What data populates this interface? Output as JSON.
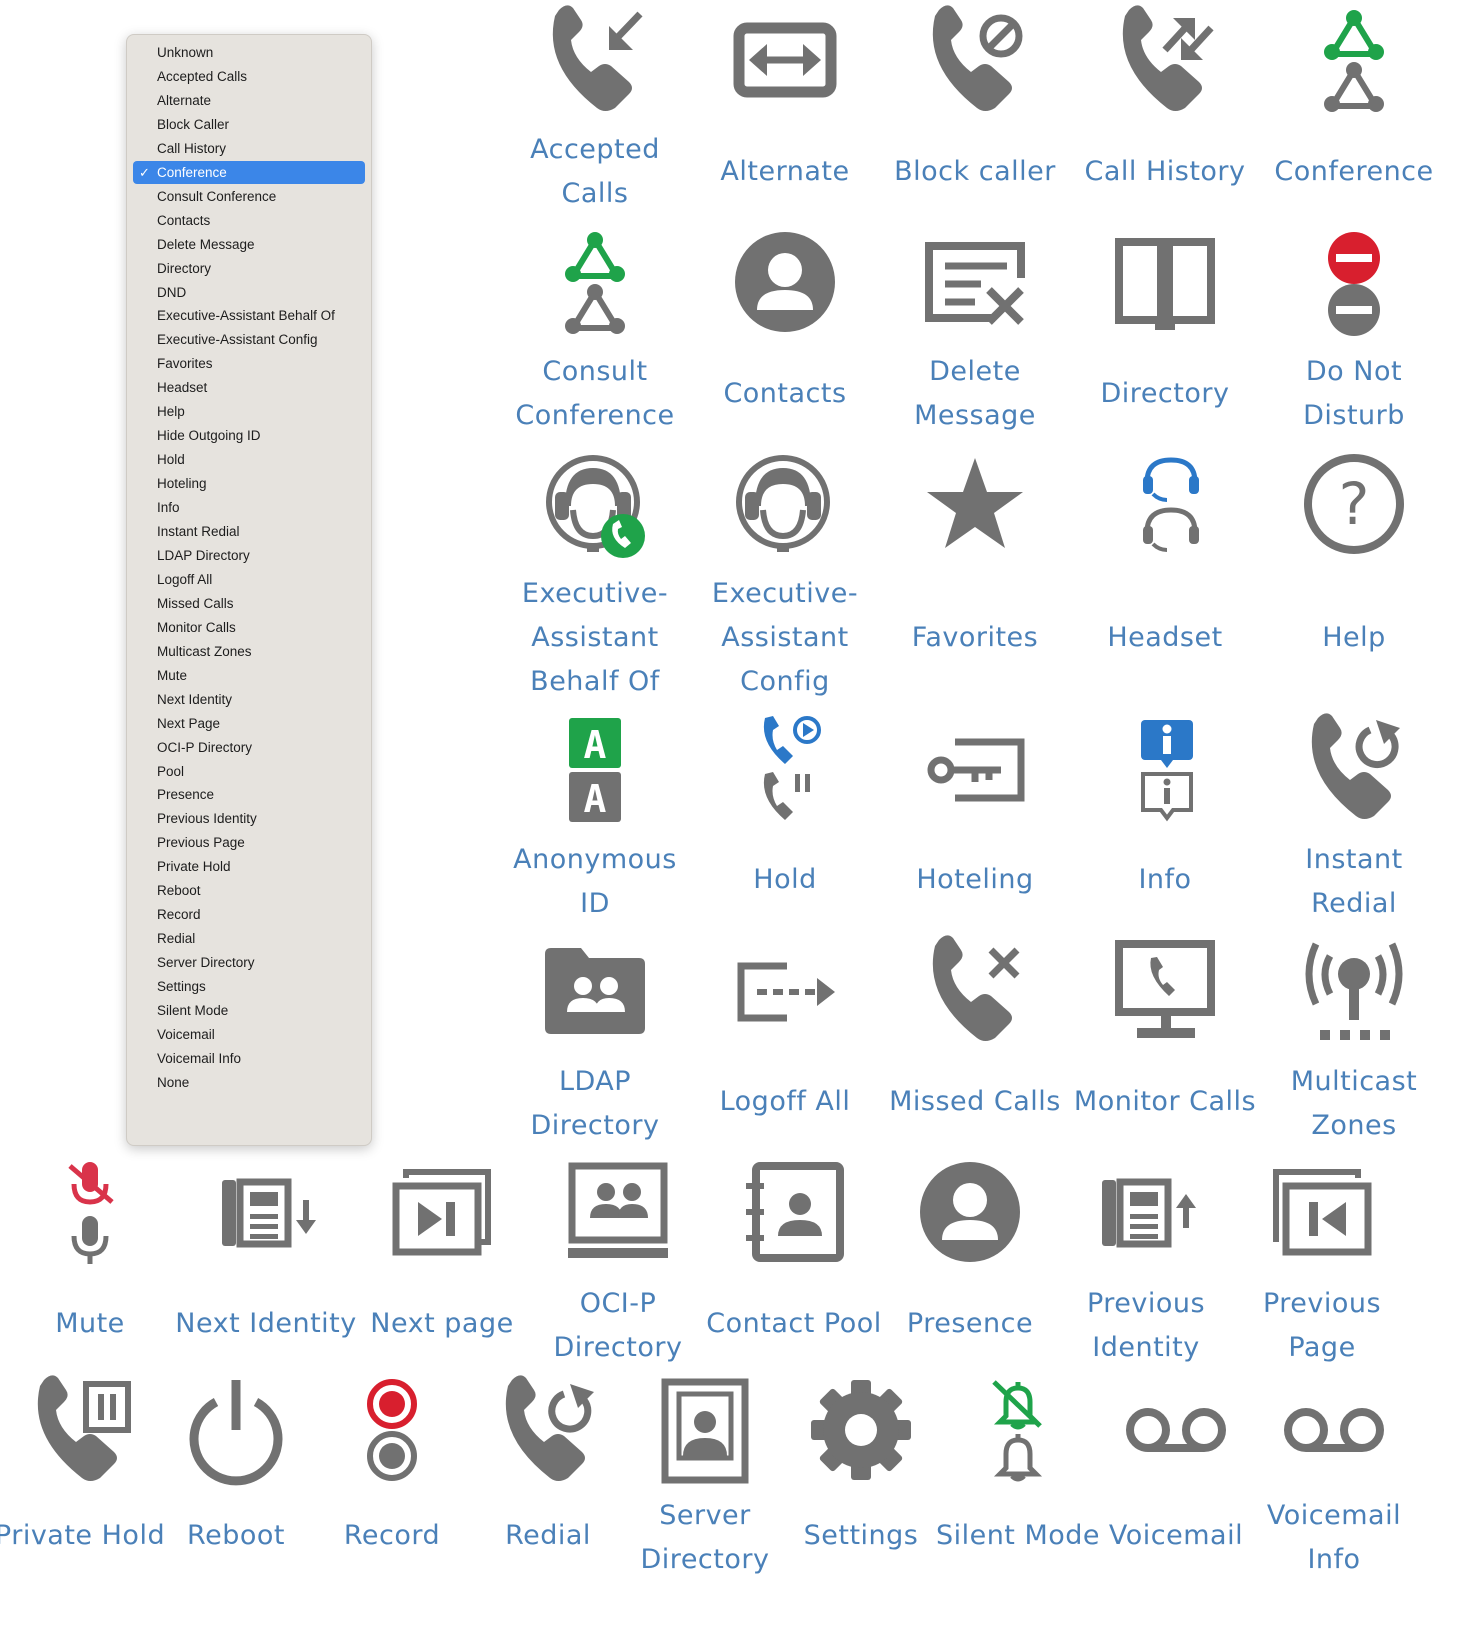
{
  "menu": {
    "items": [
      {
        "label": "Unknown"
      },
      {
        "label": "Accepted Calls"
      },
      {
        "label": "Alternate"
      },
      {
        "label": "Block Caller"
      },
      {
        "label": "Call History"
      },
      {
        "label": "Conference",
        "selected": true
      },
      {
        "label": "Consult Conference"
      },
      {
        "label": "Contacts"
      },
      {
        "label": "Delete Message"
      },
      {
        "label": "Directory"
      },
      {
        "label": "DND"
      },
      {
        "label": "Executive-Assistant Behalf Of"
      },
      {
        "label": "Executive-Assistant Config"
      },
      {
        "label": "Favorites"
      },
      {
        "label": "Headset"
      },
      {
        "label": "Help"
      },
      {
        "label": "Hide Outgoing ID"
      },
      {
        "label": "Hold"
      },
      {
        "label": "Hoteling"
      },
      {
        "label": "Info"
      },
      {
        "label": "Instant Redial"
      },
      {
        "label": "LDAP Directory"
      },
      {
        "label": "Logoff All"
      },
      {
        "label": "Missed Calls"
      },
      {
        "label": "Monitor Calls"
      },
      {
        "label": "Multicast Zones"
      },
      {
        "label": "Mute"
      },
      {
        "label": "Next Identity"
      },
      {
        "label": "Next Page"
      },
      {
        "label": "OCI-P Directory"
      },
      {
        "label": "Pool"
      },
      {
        "label": "Presence"
      },
      {
        "label": "Previous Identity"
      },
      {
        "label": "Previous Page"
      },
      {
        "label": "Private Hold"
      },
      {
        "label": "Reboot"
      },
      {
        "label": "Record"
      },
      {
        "label": "Redial"
      },
      {
        "label": "Server Directory"
      },
      {
        "label": "Settings"
      },
      {
        "label": "Silent Mode"
      },
      {
        "label": "Voicemail"
      },
      {
        "label": "Voicemail Info"
      },
      {
        "label": "None"
      }
    ],
    "check_glyph": "✓"
  },
  "icons": {
    "accepted_calls": [
      "Accepted",
      "Calls"
    ],
    "alternate": [
      "Alternate"
    ],
    "block_caller": [
      "Block caller"
    ],
    "call_history": [
      "Call History"
    ],
    "conference": [
      "Conference"
    ],
    "consult_conference": [
      "Consult",
      "Conference"
    ],
    "contacts": [
      "Contacts"
    ],
    "delete_message": [
      "Delete",
      "Message"
    ],
    "directory": [
      "Directory"
    ],
    "do_not_disturb": [
      "Do Not",
      "Disturb"
    ],
    "exec_behalf": [
      "Executive-",
      "Assistant",
      "Behalf Of"
    ],
    "exec_config": [
      "Executive-",
      "Assistant",
      "Config"
    ],
    "favorites": [
      "Favorites"
    ],
    "headset": [
      "Headset"
    ],
    "help": [
      "Help"
    ],
    "anonymous_id": [
      "Anonymous",
      "ID"
    ],
    "hold": [
      "Hold"
    ],
    "hoteling": [
      "Hoteling"
    ],
    "info": [
      "Info"
    ],
    "instant_redial": [
      "Instant",
      "Redial"
    ],
    "ldap_directory": [
      "LDAP",
      "Directory"
    ],
    "logoff_all": [
      "Logoff All"
    ],
    "missed_calls": [
      "Missed Calls"
    ],
    "monitor_calls": [
      "Monitor Calls"
    ],
    "multicast_zones": [
      "Multicast",
      "Zones"
    ],
    "mute": [
      "Mute"
    ],
    "next_identity": [
      "Next Identity"
    ],
    "next_page": [
      "Next page"
    ],
    "ocip_directory": [
      "OCI-P",
      "Directory"
    ],
    "contact_pool": [
      "Contact Pool"
    ],
    "presence": [
      "Presence"
    ],
    "previous_identity": [
      "Previous",
      "Identity"
    ],
    "previous_page": [
      "Previous",
      "Page"
    ],
    "private_hold": [
      "Private Hold"
    ],
    "reboot": [
      "Reboot"
    ],
    "record": [
      "Record"
    ],
    "redial": [
      "Redial"
    ],
    "server_directory": [
      "Server",
      "Directory"
    ],
    "settings": [
      "Settings"
    ],
    "silent_mode": [
      "Silent Mode"
    ],
    "voicemail": [
      "Voicemail"
    ],
    "voicemail_info": [
      "Voicemail",
      "Info"
    ]
  },
  "colors": {
    "icon_gray": "#717171",
    "label_blue": "#4a80b8",
    "active_green": "#1fa34a",
    "active_blue": "#2b78c8",
    "dnd_red": "#d81f2e",
    "mute_red": "#d9334a",
    "menu_bg": "#e6e3de",
    "menu_selection": "#3b86e8"
  }
}
